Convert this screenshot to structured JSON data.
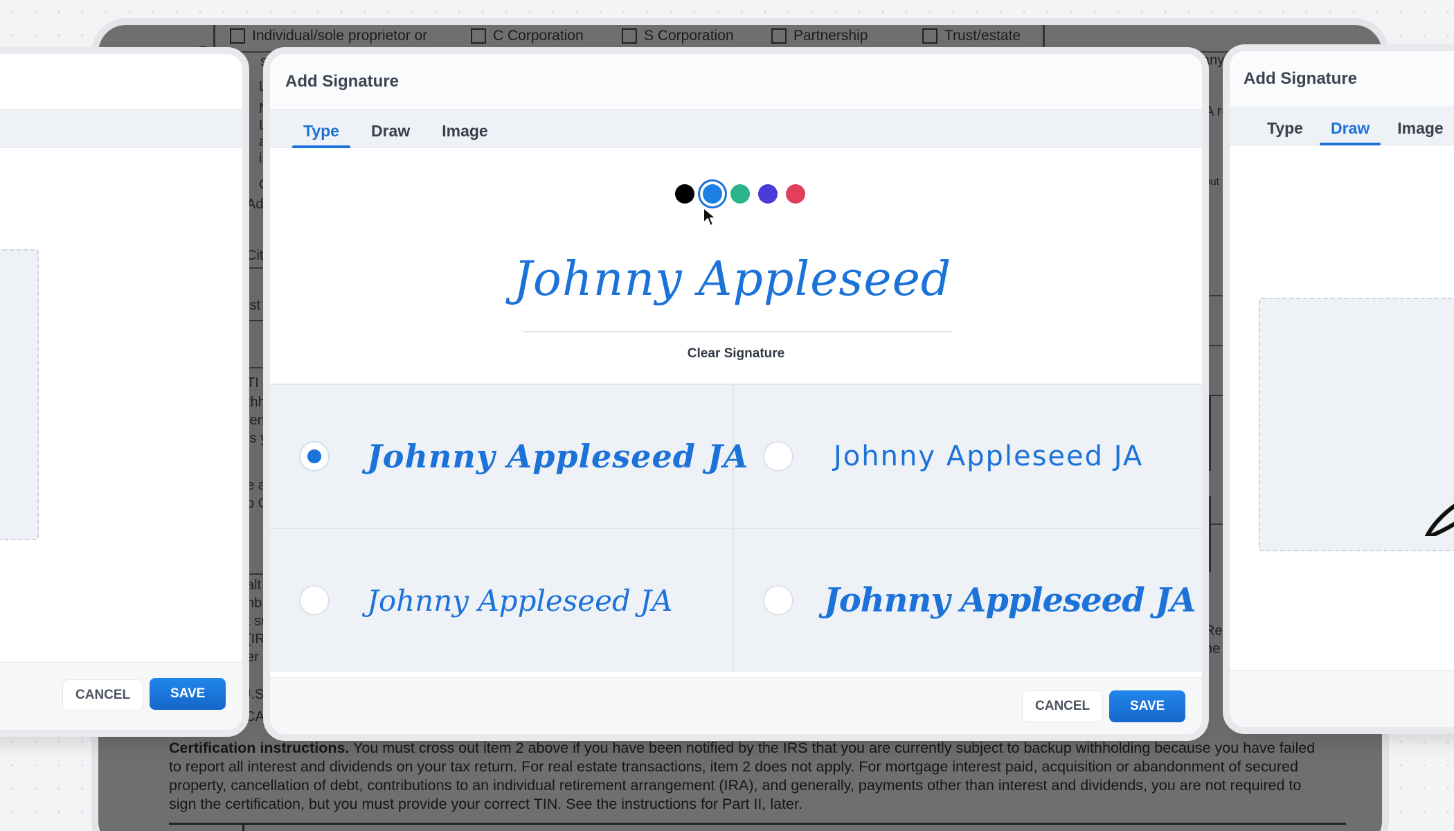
{
  "document": {
    "rotated_label": "on",
    "checkboxes": [
      {
        "label": "Individual/sole proprietor or"
      },
      {
        "label": "C Corporation"
      },
      {
        "label": "S Corporation"
      },
      {
        "label": "Partnership"
      },
      {
        "label": "Trust/estate"
      }
    ],
    "fragments": [
      "si",
      "L",
      "N",
      "L",
      "a",
      "is",
      "C",
      "Add",
      "City",
      "ist a",
      "TI",
      "thh",
      "ien",
      "is y",
      "e a",
      "o G",
      "alt",
      "nb",
      "t su",
      "(IR",
      "er s",
      "U.S",
      "TCA",
      "any)",
      "A re",
      "out",
      "Re",
      "ne"
    ],
    "certification_heading": "Certification instructions.",
    "certification_body": " You must cross out item 2 above if you have been notified by the IRS that you are currently subject to backup withholding because you have failed to report all interest and dividends on your tax return. For real estate transactions, item 2 does not apply. For mortgage interest paid, acquisition or abandonment of secured property, cancellation of debt, contributions to an individual retirement arrangement (IRA), and generally, payments other than interest and dividends, you are not required to sign the certification, but you must provide your correct TIN. See the instructions for Part II, later."
  },
  "left_dialog": {
    "cancel_label": "CANCEL",
    "save_label": "SAVE"
  },
  "main_dialog": {
    "title": "Add Signature",
    "tabs": [
      {
        "label": "Type",
        "active": true
      },
      {
        "label": "Draw",
        "active": false
      },
      {
        "label": "Image",
        "active": false
      }
    ],
    "colors": [
      {
        "name": "black",
        "hex": "#000000"
      },
      {
        "name": "blue",
        "hex": "#1b7fe3",
        "selected": true
      },
      {
        "name": "green",
        "hex": "#2bb38a"
      },
      {
        "name": "purple",
        "hex": "#4b3bd6"
      },
      {
        "name": "red",
        "hex": "#e0405c"
      }
    ],
    "signature_text": "Johnny Appleseed",
    "clear_label": "Clear Signature",
    "style_options": [
      {
        "text": "Johnny Appleseed JA",
        "selected": true
      },
      {
        "text": "Johnny Appleseed JA",
        "selected": false
      },
      {
        "text": "Johnny Appleseed JA",
        "selected": false
      },
      {
        "text": "Johnny Appleseed JA",
        "selected": false
      }
    ],
    "cancel_label": "CANCEL",
    "save_label": "SAVE"
  },
  "right_dialog": {
    "title": "Add Signature",
    "tabs": [
      {
        "label": "Type",
        "active": false
      },
      {
        "label": "Draw",
        "active": true
      },
      {
        "label": "Image",
        "active": false
      }
    ]
  },
  "accent_color": "#1b72d8"
}
